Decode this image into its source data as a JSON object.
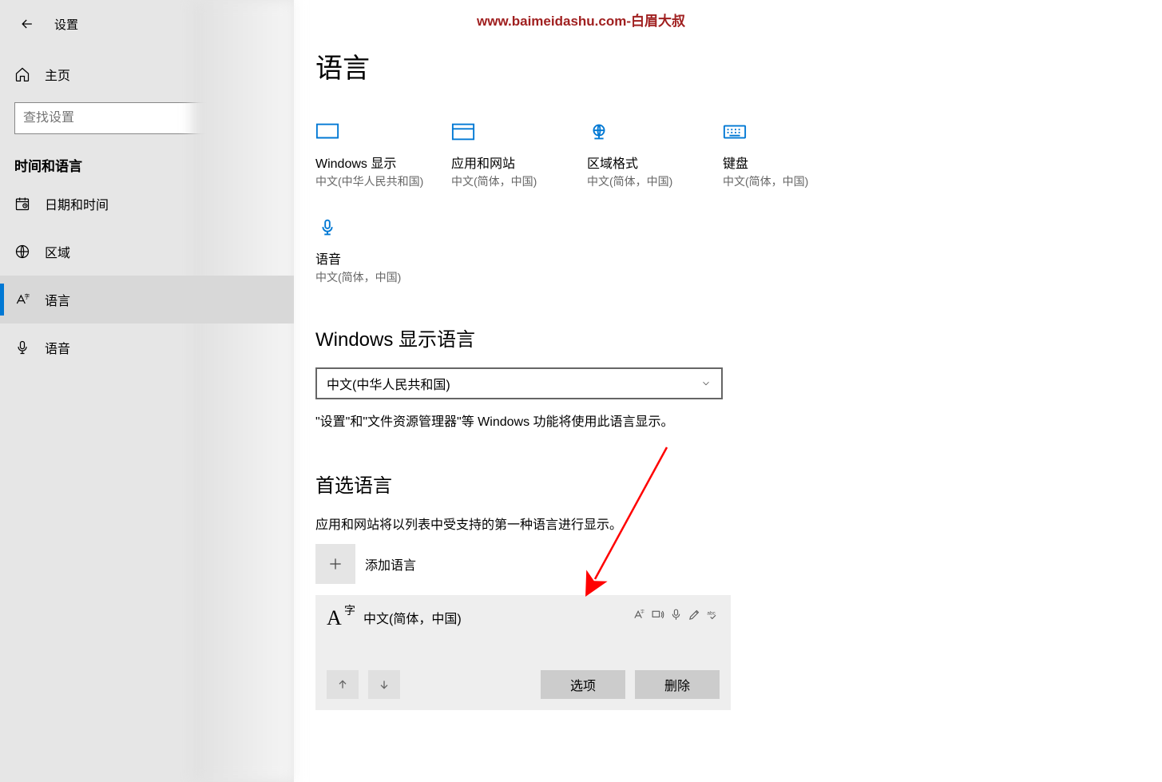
{
  "watermark": "www.baimeidashu.com-白眉大叔",
  "header": {
    "settings_label": "设置"
  },
  "sidebar": {
    "home": "主页",
    "search_placeholder": "查找设置",
    "category": "时间和语言",
    "items": [
      {
        "label": "日期和时间"
      },
      {
        "label": "区域"
      },
      {
        "label": "语言"
      },
      {
        "label": "语音"
      }
    ]
  },
  "main": {
    "title": "语言",
    "tiles": [
      {
        "title": "Windows 显示",
        "sub": "中文(中华人民共和国)"
      },
      {
        "title": "应用和网站",
        "sub": "中文(简体，中国)"
      },
      {
        "title": "区域格式",
        "sub": "中文(简体，中国)"
      },
      {
        "title": "键盘",
        "sub": "中文(简体，中国)"
      },
      {
        "title": "语音",
        "sub": "中文(简体，中国)"
      }
    ],
    "display_lang_section": "Windows 显示语言",
    "display_lang_value": "中文(中华人民共和国)",
    "display_lang_help": "\"设置\"和\"文件资源管理器\"等 Windows 功能将使用此语言显示。",
    "preferred_section": "首选语言",
    "preferred_help": "应用和网站将以列表中受支持的第一种语言进行显示。",
    "add_language": "添加语言",
    "selected_lang": "中文(简体，中国)",
    "options_btn": "选项",
    "remove_btn": "删除"
  }
}
